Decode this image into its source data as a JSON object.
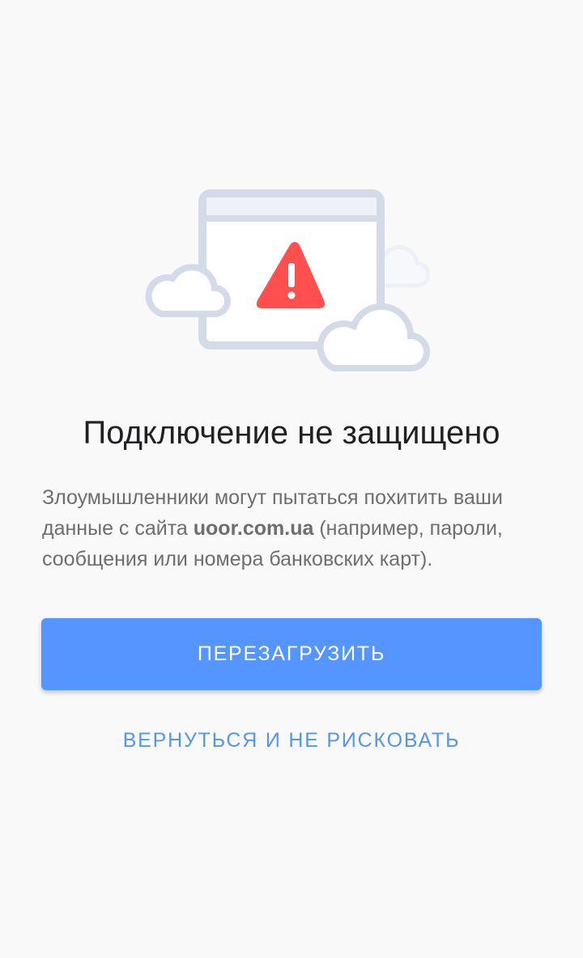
{
  "illustration": {
    "icon": "browser-warning-icon",
    "warning_color": "#ff4f4f",
    "frame_color": "#d3dae8"
  },
  "page": {
    "title": "Подключение не защищено",
    "description_before": "Злоумышленники могут пытаться похитить ваши данные с сайта ",
    "site": "uoor.com.ua",
    "description_after": " (например, пароли, сообщения или номера банковских карт)."
  },
  "actions": {
    "reload_label": "ПЕРЕЗАГРУЗИТЬ",
    "back_label": "ВЕРНУТЬСЯ И НЕ РИСКОВАТЬ"
  },
  "colors": {
    "background": "#f9f9f9",
    "primary": "#5595ff",
    "link": "#5595f0"
  }
}
